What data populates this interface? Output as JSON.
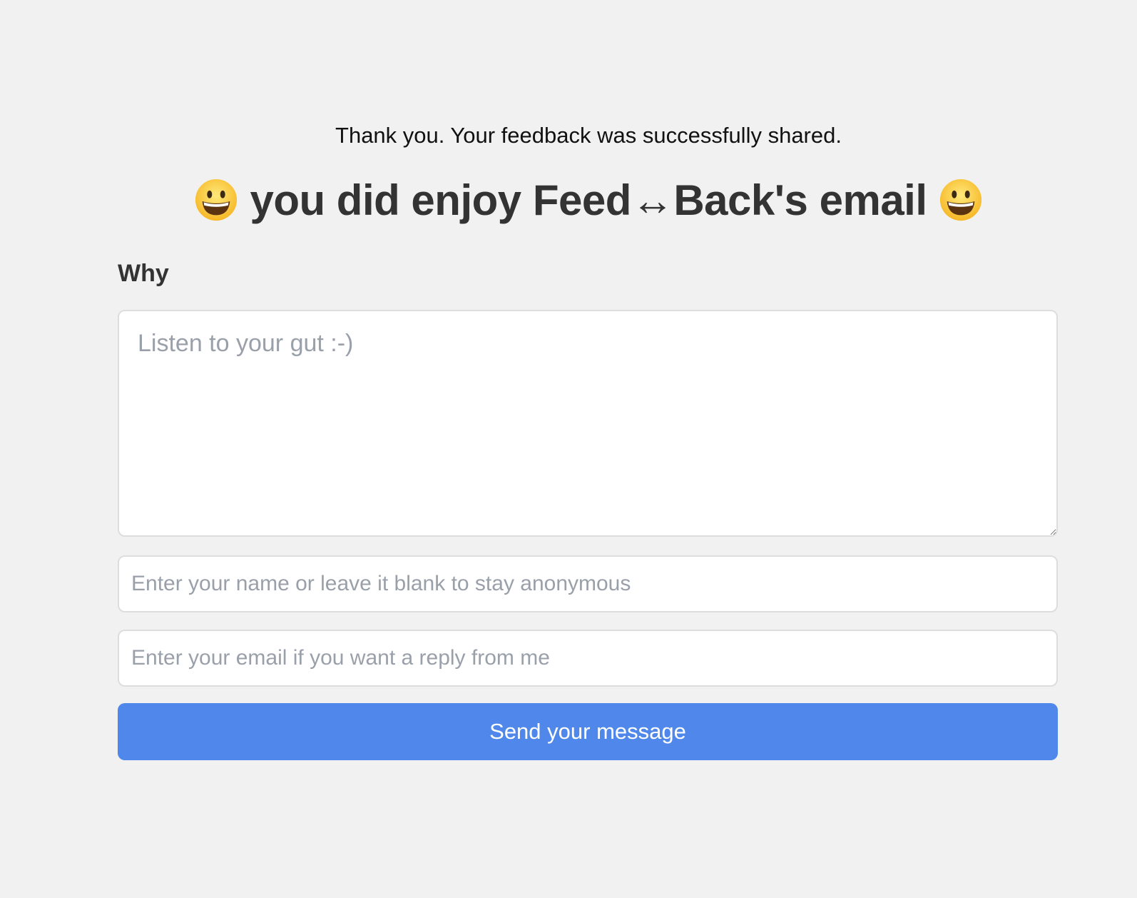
{
  "notice": "Thank you. Your feedback was successfully shared.",
  "headline": {
    "left_icon": "grinning-face-emoji",
    "text": "you did enjoy Feed↔Back's email",
    "right_icon": "grinning-face-emoji"
  },
  "form": {
    "why_label": "Why",
    "why_placeholder": "Listen to your gut :-)",
    "name_placeholder": "Enter your name or leave it blank to stay anonymous",
    "email_placeholder": "Enter your email if you want a reply from me",
    "submit_label": "Send your message"
  },
  "colors": {
    "background": "#f1f1f1",
    "button": "#4f88ea",
    "placeholder": "#9aa0aa",
    "heading": "#333333"
  }
}
